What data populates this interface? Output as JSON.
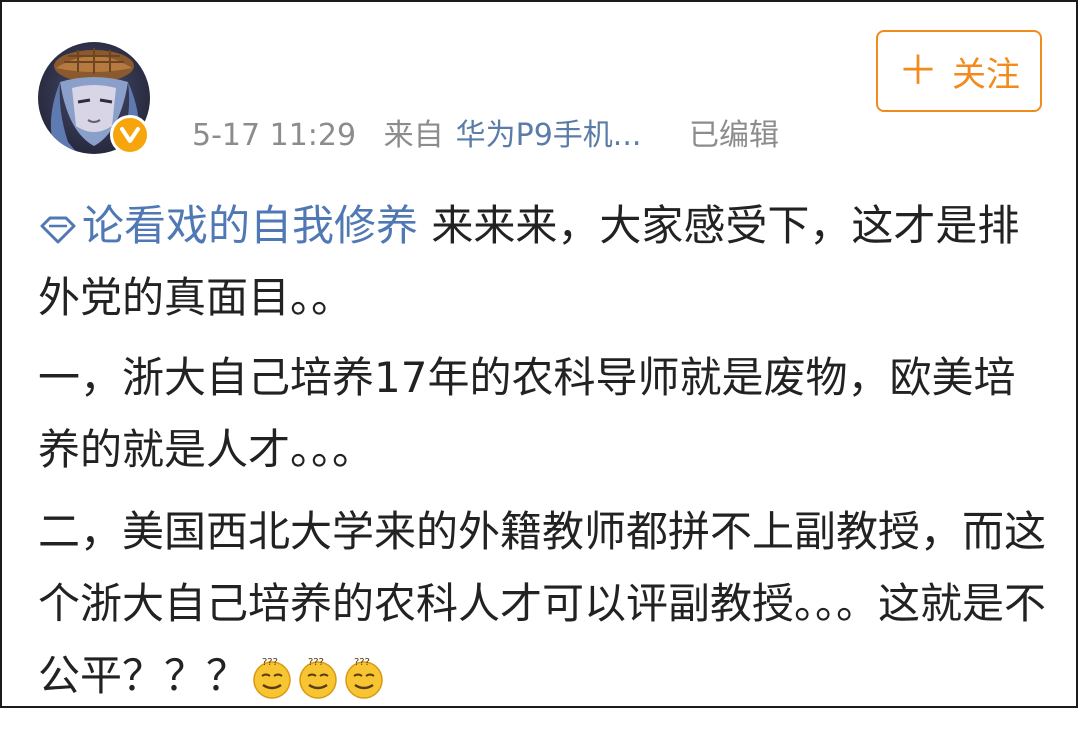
{
  "post": {
    "timestamp": "5-17 11:29",
    "source_prefix": "来自",
    "source_device": "华为P9手机...",
    "edited_label": "已编辑",
    "follow_button": {
      "icon": "plus-icon",
      "label": "关注"
    },
    "avatar": {
      "icon": "avatar-image",
      "badge_icon": "verified-badge-icon",
      "badge_color": "#f6a60c"
    },
    "colors": {
      "accent": "#f28b1e",
      "link": "#4f78b5",
      "meta": "#8c8c8c",
      "text": "#222222"
    },
    "topic": {
      "icon": "topic-diamond-icon",
      "label": "论看戏的自我修养"
    },
    "paragraph1_text": " 来来来，大家感受下，这才是排外党的真面目。。",
    "paragraph2_text": "一，浙大自己培养17年的农科导师就是废物，欧美培养的就是人才。。。",
    "paragraph3_text": "二，美国西北大学来的外籍教师都拼不上副教授，而这个浙大自己培养的农科人才可以评副教授。。。这就是不公平？？？",
    "emojis": [
      "doubt-face-emoji",
      "doubt-face-emoji",
      "doubt-face-emoji"
    ]
  }
}
